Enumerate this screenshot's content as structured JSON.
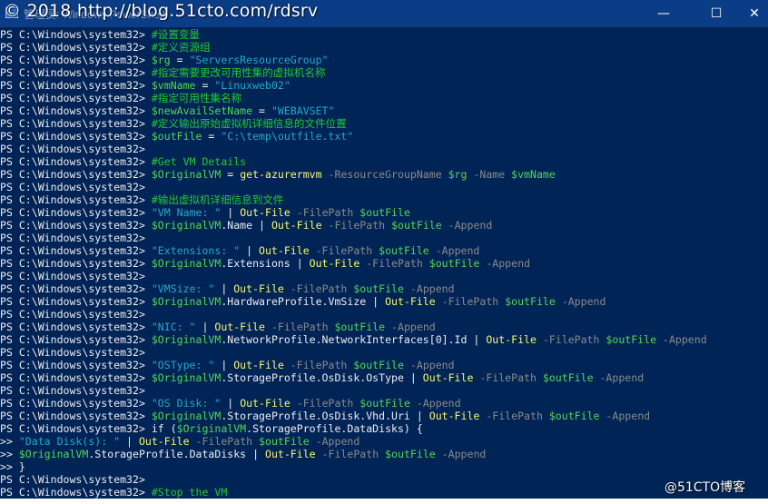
{
  "window": {
    "title": "管理员: Windows PowerShell",
    "watermark_top": "© 2018 http://blog.51cto.com/rdsrv",
    "watermark_bottom": "@51CTO博客",
    "buttons": {
      "minimize": "—",
      "maximize": "☐",
      "close": "✕"
    },
    "colors": {
      "background": "#012456",
      "titlebar": "#0b3d86",
      "comment": "#22c832",
      "keyword": "#f7f76e",
      "variable": "#53d657",
      "string": "#26a6c7",
      "parameter": "#8a8a8a",
      "text": "#eeedf0"
    }
  },
  "console": {
    "lines": [
      [
        [
          "txt",
          "PS C:\\Windows\\system32> "
        ],
        [
          "cmt",
          "#设置变量"
        ]
      ],
      [
        [
          "txt",
          "PS C:\\Windows\\system32> "
        ],
        [
          "cmt",
          "#定义资源组"
        ]
      ],
      [
        [
          "txt",
          "PS C:\\Windows\\system32> "
        ],
        [
          "var",
          "$rg"
        ],
        [
          "txt",
          " = "
        ],
        [
          "str",
          "\"ServersResourceGroup\""
        ]
      ],
      [
        [
          "txt",
          "PS C:\\Windows\\system32> "
        ],
        [
          "cmt",
          "#指定需要更改可用性集的虚拟机名称"
        ]
      ],
      [
        [
          "txt",
          "PS C:\\Windows\\system32> "
        ],
        [
          "var",
          "$vmName"
        ],
        [
          "txt",
          " = "
        ],
        [
          "str",
          "\"Linuxweb02\""
        ]
      ],
      [
        [
          "txt",
          "PS C:\\Windows\\system32> "
        ],
        [
          "cmt",
          "#指定可用性集名称"
        ]
      ],
      [
        [
          "txt",
          "PS C:\\Windows\\system32> "
        ],
        [
          "var",
          "$newAvailSetName"
        ],
        [
          "txt",
          " = "
        ],
        [
          "str",
          "\"WEBAVSET\""
        ]
      ],
      [
        [
          "txt",
          "PS C:\\Windows\\system32> "
        ],
        [
          "cmt",
          "#定义输出原始虚拟机详细信息的文件位置"
        ]
      ],
      [
        [
          "txt",
          "PS C:\\Windows\\system32> "
        ],
        [
          "var",
          "$outFile"
        ],
        [
          "txt",
          " = "
        ],
        [
          "str",
          "\"C:\\temp\\outfile.txt\""
        ]
      ],
      [
        [
          "txt",
          "PS C:\\Windows\\system32>"
        ]
      ],
      [
        [
          "txt",
          "PS C:\\Windows\\system32> "
        ],
        [
          "cmt",
          "#Get VM Details"
        ]
      ],
      [
        [
          "txt",
          "PS C:\\Windows\\system32> "
        ],
        [
          "var",
          "$OriginalVM"
        ],
        [
          "txt",
          " = "
        ],
        [
          "kw",
          "get-azurermvm"
        ],
        [
          "prm",
          " -ResourceGroupName "
        ],
        [
          "var",
          "$rg"
        ],
        [
          "prm",
          " -Name "
        ],
        [
          "var",
          "$vmName"
        ]
      ],
      [
        [
          "txt",
          "PS C:\\Windows\\system32>"
        ]
      ],
      [
        [
          "txt",
          "PS C:\\Windows\\system32> "
        ],
        [
          "cmt",
          "#输出虚拟机详细信息到文件"
        ]
      ],
      [
        [
          "txt",
          "PS C:\\Windows\\system32> "
        ],
        [
          "str",
          "\"VM Name: \""
        ],
        [
          "txt",
          " | "
        ],
        [
          "kw",
          "Out-File"
        ],
        [
          "prm",
          " -FilePath "
        ],
        [
          "var",
          "$outFile"
        ]
      ],
      [
        [
          "txt",
          "PS C:\\Windows\\system32> "
        ],
        [
          "var",
          "$OriginalVM"
        ],
        [
          "txt",
          ".Name | "
        ],
        [
          "kw",
          "Out-File"
        ],
        [
          "prm",
          " -FilePath "
        ],
        [
          "var",
          "$outFile"
        ],
        [
          "prm",
          " -Append"
        ]
      ],
      [
        [
          "txt",
          "PS C:\\Windows\\system32>"
        ]
      ],
      [
        [
          "txt",
          "PS C:\\Windows\\system32> "
        ],
        [
          "str",
          "\"Extensions: \""
        ],
        [
          "txt",
          " | "
        ],
        [
          "kw",
          "Out-File"
        ],
        [
          "prm",
          " -FilePath "
        ],
        [
          "var",
          "$outFile"
        ],
        [
          "prm",
          " -Append"
        ]
      ],
      [
        [
          "txt",
          "PS C:\\Windows\\system32> "
        ],
        [
          "var",
          "$OriginalVM"
        ],
        [
          "txt",
          ".Extensions | "
        ],
        [
          "kw",
          "Out-File"
        ],
        [
          "prm",
          " -FilePath "
        ],
        [
          "var",
          "$outFile"
        ],
        [
          "prm",
          " -Append"
        ]
      ],
      [
        [
          "txt",
          "PS C:\\Windows\\system32>"
        ]
      ],
      [
        [
          "txt",
          "PS C:\\Windows\\system32> "
        ],
        [
          "str",
          "\"VMSize: \""
        ],
        [
          "txt",
          " | "
        ],
        [
          "kw",
          "Out-File"
        ],
        [
          "prm",
          " -FilePath "
        ],
        [
          "var",
          "$outFile"
        ],
        [
          "prm",
          " -Append"
        ]
      ],
      [
        [
          "txt",
          "PS C:\\Windows\\system32> "
        ],
        [
          "var",
          "$OriginalVM"
        ],
        [
          "txt",
          ".HardwareProfile.VmSize | "
        ],
        [
          "kw",
          "Out-File"
        ],
        [
          "prm",
          " -FilePath "
        ],
        [
          "var",
          "$outFile"
        ],
        [
          "prm",
          " -Append"
        ]
      ],
      [
        [
          "txt",
          "PS C:\\Windows\\system32>"
        ]
      ],
      [
        [
          "txt",
          "PS C:\\Windows\\system32> "
        ],
        [
          "str",
          "\"NIC: \""
        ],
        [
          "txt",
          " | "
        ],
        [
          "kw",
          "Out-File"
        ],
        [
          "prm",
          " -FilePath "
        ],
        [
          "var",
          "$outFile"
        ],
        [
          "prm",
          " -Append"
        ]
      ],
      [
        [
          "txt",
          "PS C:\\Windows\\system32> "
        ],
        [
          "var",
          "$OriginalVM"
        ],
        [
          "txt",
          ".NetworkProfile.NetworkInterfaces[0].Id | "
        ],
        [
          "kw",
          "Out-File"
        ],
        [
          "prm",
          " -FilePath "
        ],
        [
          "var",
          "$outFile"
        ],
        [
          "prm",
          " -Append"
        ]
      ],
      [
        [
          "txt",
          "PS C:\\Windows\\system32>"
        ]
      ],
      [
        [
          "txt",
          "PS C:\\Windows\\system32> "
        ],
        [
          "str",
          "\"OSType: \""
        ],
        [
          "txt",
          " | "
        ],
        [
          "kw",
          "Out-File"
        ],
        [
          "prm",
          " -FilePath "
        ],
        [
          "var",
          "$outFile"
        ],
        [
          "prm",
          " -Append"
        ]
      ],
      [
        [
          "txt",
          "PS C:\\Windows\\system32> "
        ],
        [
          "var",
          "$OriginalVM"
        ],
        [
          "txt",
          ".StorageProfile.OsDisk.OsType | "
        ],
        [
          "kw",
          "Out-File"
        ],
        [
          "prm",
          " -FilePath "
        ],
        [
          "var",
          "$outFile"
        ],
        [
          "prm",
          " -Append"
        ]
      ],
      [
        [
          "txt",
          "PS C:\\Windows\\system32>"
        ]
      ],
      [
        [
          "txt",
          "PS C:\\Windows\\system32> "
        ],
        [
          "str",
          "\"OS Disk: \""
        ],
        [
          "txt",
          " | "
        ],
        [
          "kw",
          "Out-File"
        ],
        [
          "prm",
          " -FilePath "
        ],
        [
          "var",
          "$outFile"
        ],
        [
          "prm",
          " -Append"
        ]
      ],
      [
        [
          "txt",
          "PS C:\\Windows\\system32> "
        ],
        [
          "var",
          "$OriginalVM"
        ],
        [
          "txt",
          ".StorageProfile.OsDisk.Vhd.Uri | "
        ],
        [
          "kw",
          "Out-File"
        ],
        [
          "prm",
          " -FilePath "
        ],
        [
          "var",
          "$outFile"
        ],
        [
          "prm",
          " -Append"
        ]
      ],
      [
        [
          "txt",
          "PS C:\\Windows\\system32> if ("
        ],
        [
          "var",
          "$OriginalVM"
        ],
        [
          "txt",
          ".StorageProfile.DataDisks) {"
        ]
      ],
      [
        [
          "txt",
          ">> "
        ],
        [
          "str",
          "\"Data Disk(s): \""
        ],
        [
          "txt",
          " | "
        ],
        [
          "kw",
          "Out-File"
        ],
        [
          "prm",
          " -FilePath "
        ],
        [
          "var",
          "$outFile"
        ],
        [
          "prm",
          " -Append"
        ]
      ],
      [
        [
          "txt",
          ">> "
        ],
        [
          "var",
          "$OriginalVM"
        ],
        [
          "txt",
          ".StorageProfile.DataDisks | "
        ],
        [
          "kw",
          "Out-File"
        ],
        [
          "prm",
          " -FilePath "
        ],
        [
          "var",
          "$outFile"
        ],
        [
          "prm",
          " -Append"
        ]
      ],
      [
        [
          "txt",
          ">> }"
        ]
      ],
      [
        [
          "txt",
          "PS C:\\Windows\\system32>"
        ]
      ],
      [
        [
          "txt",
          "PS C:\\Windows\\system32> "
        ],
        [
          "cmt",
          "#Stop the VM"
        ]
      ]
    ]
  }
}
